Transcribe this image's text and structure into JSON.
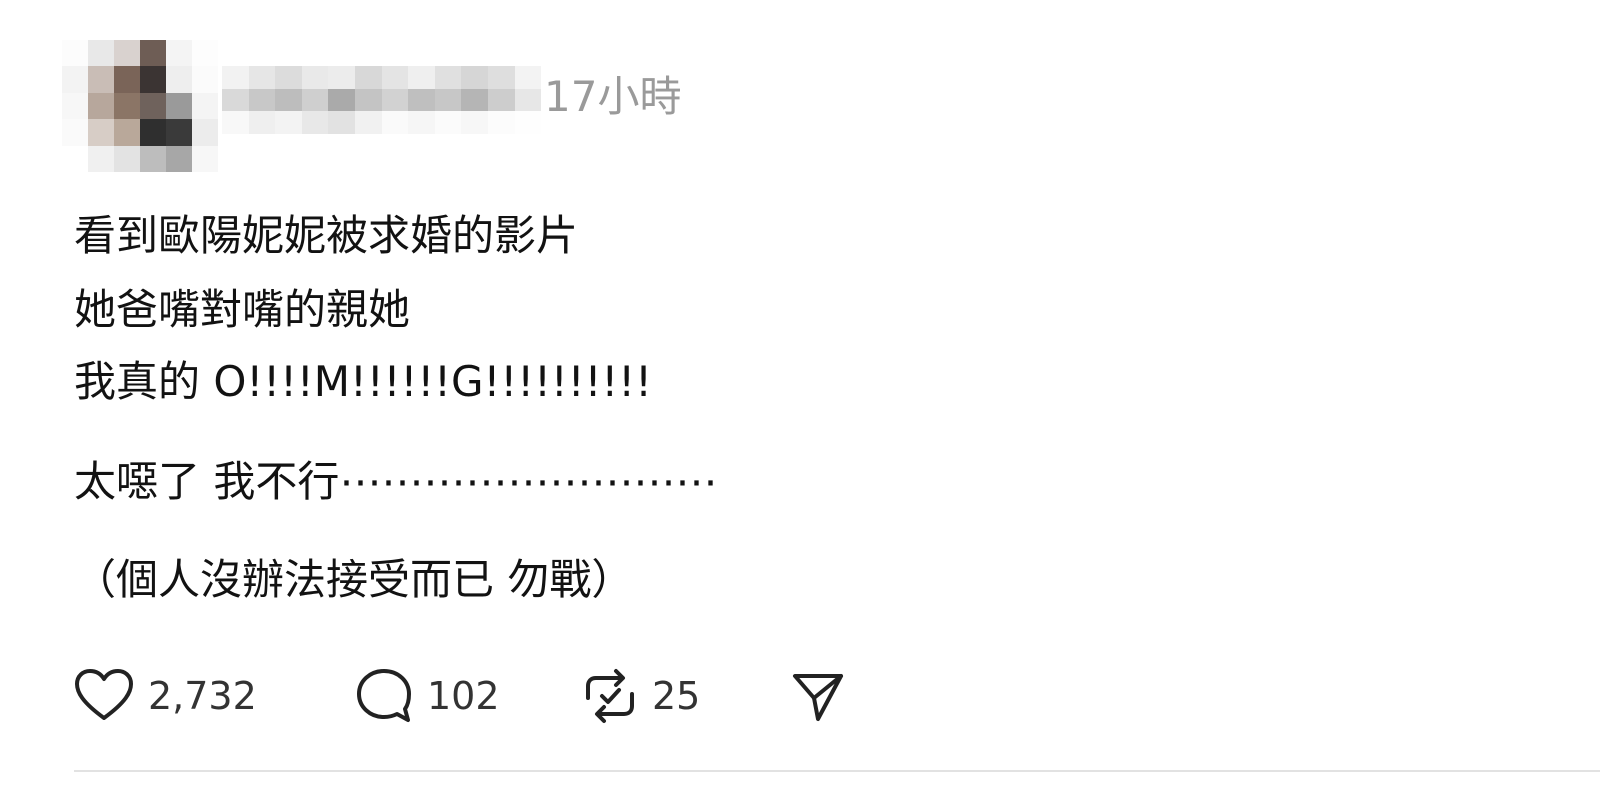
{
  "post": {
    "timestamp": "17小時",
    "lines": [
      "看到歐陽妮妮被求婚的影片",
      "她爸嘴對嘴的親她",
      "我真的 O!!!!M!!!!!!G!!!!!!!!!!",
      "太噁了 我不行⋯⋯⋯⋯⋯⋯⋯⋯⋯",
      "（個人沒辦法接受而已 勿戰）"
    ]
  },
  "actions": {
    "likes": "2,732",
    "comments": "102",
    "reposts": "25"
  },
  "icons": {
    "like": "heart-icon",
    "comment": "speech-bubble-icon",
    "repost": "repost-icon",
    "share": "send-icon"
  }
}
